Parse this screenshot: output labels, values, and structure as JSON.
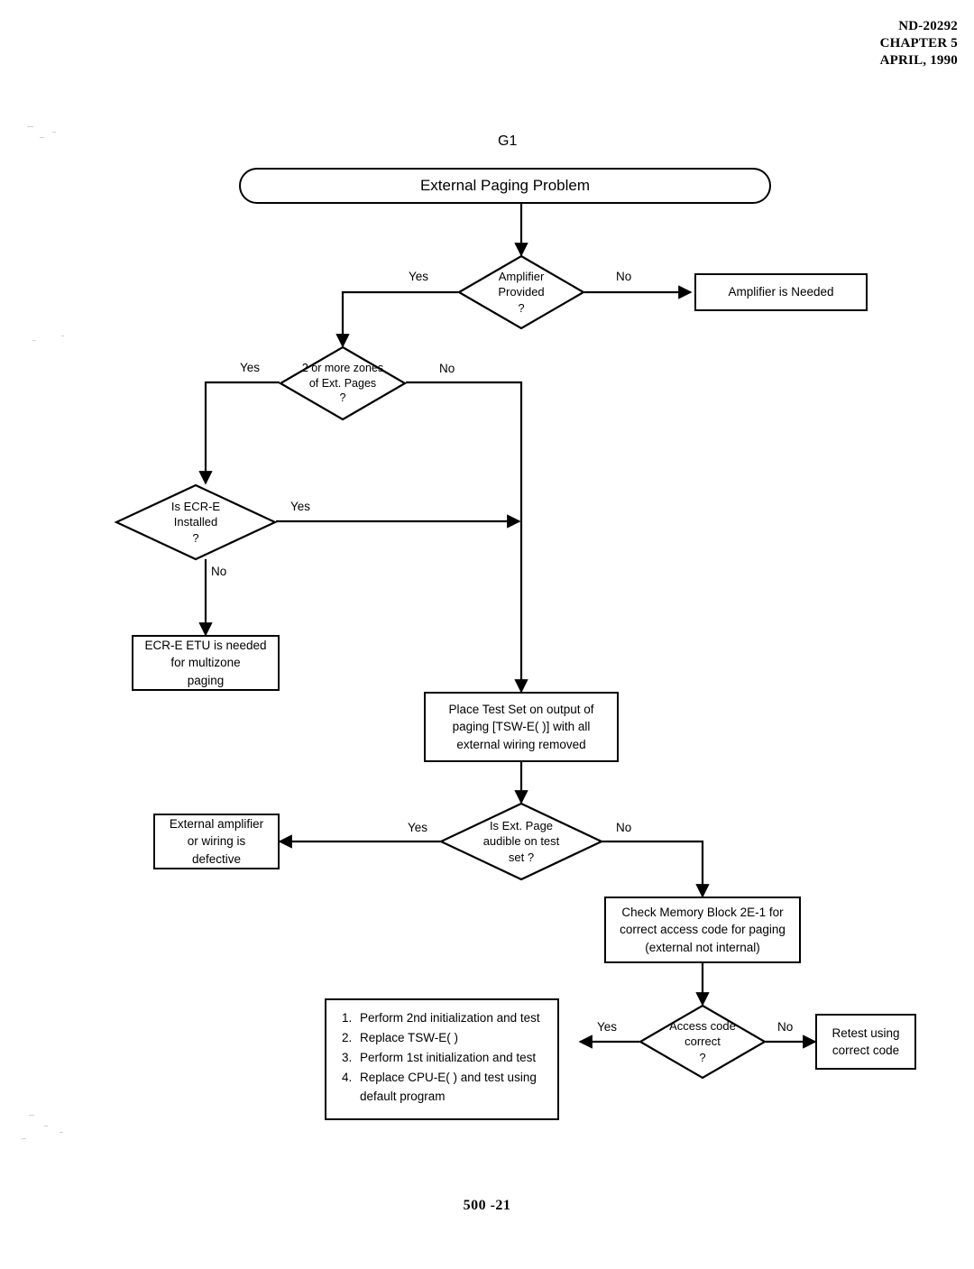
{
  "document": {
    "header_lines": [
      "ND-20292",
      "CHAPTER 5",
      "APRIL, 1990"
    ],
    "header_line1": "ND-20292",
    "header_line2": "CHAPTER 5",
    "header_line3": "APRIL, 1990",
    "footer": "500 -21"
  },
  "chart_data": {
    "type": "diagram",
    "title": "External Paging Problem",
    "group_label": "G1",
    "nodes": [
      {
        "id": "start",
        "shape": "terminator",
        "text": "External Paging Problem"
      },
      {
        "id": "amp_provided",
        "shape": "decision",
        "text": "Amplifier\nProvided\n?"
      },
      {
        "id": "amp_needed",
        "shape": "process",
        "text": "Amplifier is Needed"
      },
      {
        "id": "two_zones",
        "shape": "decision",
        "text": "2 or more zones\nof Ext. Pages\n?"
      },
      {
        "id": "ecre_installed",
        "shape": "decision",
        "text": "Is ECR-E\nInstalled\n?"
      },
      {
        "id": "ecre_etu",
        "shape": "process",
        "text": "ECR-E ETU is needed\nfor multizone\npaging"
      },
      {
        "id": "place_test_set",
        "shape": "process",
        "text": "Place Test Set on output of\npaging [TSW-E( )] with all\nexternal wiring removed"
      },
      {
        "id": "ext_page_audible",
        "shape": "decision",
        "text": "Is Ext. Page\naudible on test\nset ?"
      },
      {
        "id": "ext_amp_defect",
        "shape": "process",
        "text": "External amplifier\nor wiring is\ndefective"
      },
      {
        "id": "check_memory",
        "shape": "process",
        "text": "Check Memory Block 2E-1 for\ncorrect access code for paging\n(external not internal)"
      },
      {
        "id": "access_correct",
        "shape": "decision",
        "text": "Access code\ncorrect\n?"
      },
      {
        "id": "retest",
        "shape": "process",
        "text": "Retest using\ncorrect code"
      },
      {
        "id": "steps_list",
        "shape": "list",
        "items": [
          "Perform 2nd initialization and test",
          "Replace TSW-E( )",
          "Perform 1st initialization and test",
          "Replace  CPU-E( ) and test using default program"
        ]
      }
    ],
    "edges": [
      {
        "from": "start",
        "to": "amp_provided",
        "label": ""
      },
      {
        "from": "amp_provided",
        "to": "two_zones",
        "label": "Yes"
      },
      {
        "from": "amp_provided",
        "to": "amp_needed",
        "label": "No"
      },
      {
        "from": "two_zones",
        "to": "ecre_installed",
        "label": "Yes"
      },
      {
        "from": "two_zones",
        "to": "place_test_set",
        "label": "No"
      },
      {
        "from": "ecre_installed",
        "to": "place_test_set",
        "label": "Yes"
      },
      {
        "from": "ecre_installed",
        "to": "ecre_etu",
        "label": "No"
      },
      {
        "from": "place_test_set",
        "to": "ext_page_audible",
        "label": ""
      },
      {
        "from": "ext_page_audible",
        "to": "ext_amp_defect",
        "label": "Yes"
      },
      {
        "from": "ext_page_audible",
        "to": "check_memory",
        "label": "No"
      },
      {
        "from": "check_memory",
        "to": "access_correct",
        "label": ""
      },
      {
        "from": "access_correct",
        "to": "steps_list",
        "label": "Yes"
      },
      {
        "from": "access_correct",
        "to": "retest",
        "label": "No"
      }
    ]
  },
  "flow": {
    "group_label": "G1",
    "start": {
      "text": "External Paging Problem"
    },
    "amp_provided": {
      "text": "Amplifier\nProvided\n?"
    },
    "amp_needed": {
      "text": "Amplifier is Needed"
    },
    "two_zones": {
      "text": "2 or more zones\nof Ext. Pages\n?"
    },
    "ecre_installed": {
      "text": "Is ECR-E\nInstalled\n?"
    },
    "ecre_etu": {
      "text": "ECR-E ETU is needed\nfor multizone\npaging"
    },
    "place_test_set": {
      "text": "Place Test Set on output of\npaging [TSW-E( )] with all\nexternal wiring removed"
    },
    "ext_page_audible": {
      "text": "Is Ext. Page\naudible on test\nset ?"
    },
    "ext_amp_defect": {
      "text": "External amplifier\nor wiring is\ndefective"
    },
    "check_memory": {
      "text": "Check Memory Block 2E-1 for\ncorrect access code for paging\n(external not internal)"
    },
    "access_correct": {
      "text": "Access code\ncorrect\n?"
    },
    "retest": {
      "text": "Retest using\ncorrect code"
    },
    "steps": {
      "item1": "Perform 2nd initialization and test",
      "item2": "Replace TSW-E( )",
      "item3": "Perform 1st initialization and test",
      "item4": "Replace  CPU-E( ) and test using default program"
    },
    "labels": {
      "amp_yes": "Yes",
      "amp_no": "No",
      "zones_yes": "Yes",
      "zones_no": "No",
      "ecre_yes": "Yes",
      "ecre_no": "No",
      "audible_yes": "Yes",
      "audible_no": "No",
      "access_yes": "Yes",
      "access_no": "No"
    }
  }
}
